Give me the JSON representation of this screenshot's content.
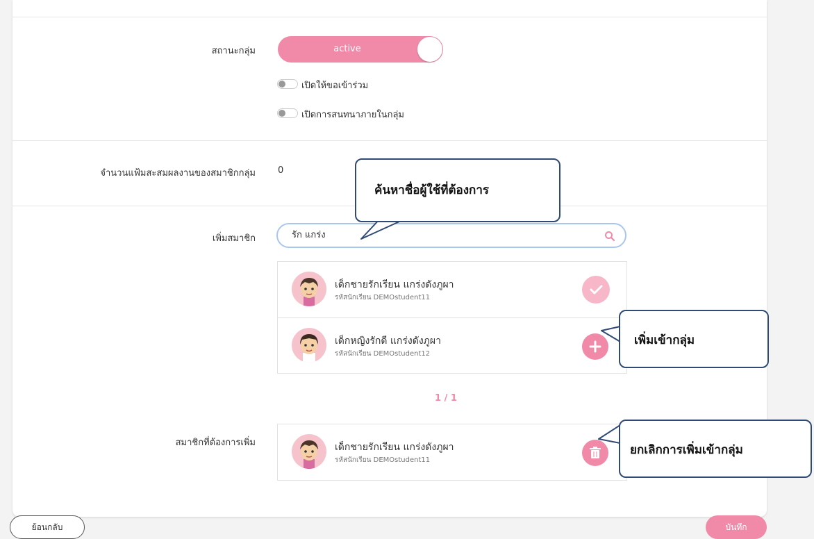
{
  "group_status": {
    "label": "สถานะกลุ่ม",
    "toggle_text": "active"
  },
  "options": [
    {
      "label": "เปิดให้ขอเข้าร่วม"
    },
    {
      "label": "เปิดการสนทนาภายในกลุ่ม"
    }
  ],
  "portfolio": {
    "label": "จำนวนแฟ้มสะสมผลงานของสมาชิกกลุ่ม",
    "value": "0"
  },
  "add_member": {
    "label": "เพิ่มสมาชิก",
    "search_value": "รัก แกร่ง"
  },
  "results": [
    {
      "name": "เด็กชายรักเรียน แกร่งดังภูผา",
      "code": "รหัสนักเรียน DEMOstudent11",
      "state": "added",
      "icon": "check-icon"
    },
    {
      "name": "เด็กหญิงรักดี แกร่งดังภูผา",
      "code": "รหัสนักเรียน DEMOstudent12",
      "state": "add",
      "icon": "plus-icon"
    }
  ],
  "pagination": "1 / 1",
  "selected": {
    "label": "สมาชิกที่ต้องการเพิ่ม",
    "items": [
      {
        "name": "เด็กชายรักเรียน แกร่งดังภูผา",
        "code": "รหัสนักเรียน DEMOstudent11",
        "icon": "trash-icon"
      }
    ]
  },
  "buttons": {
    "back": "ย้อนกลับ",
    "save": "บันทึก"
  },
  "callouts": {
    "search_hint": "ค้นหาชื่อผู้ใช้ที่ต้องการ",
    "add_hint": "เพิ่มเข้ากลุ่ม",
    "remove_hint": "ยกเลิกการเพิ่มเข้ากลุ่ม"
  },
  "colors": {
    "accent": "#f08aa8",
    "callout_border": "#2f4a74",
    "search_border": "#a9c6ef"
  }
}
